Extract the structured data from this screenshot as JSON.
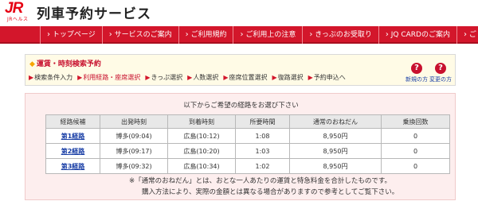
{
  "header": {
    "logo_text": "JR",
    "logo_sub": "JRヘルス",
    "title": "列車予約サービス"
  },
  "nav": {
    "items": [
      "トップページ",
      "サービスのご案内",
      "ご利用規約",
      "ご利用上の注意",
      "きっぷのお受取り",
      "JQ CARDのご案内",
      "ご"
    ]
  },
  "steps_panel": {
    "title": "運賃・時刻検索予約",
    "steps": [
      "検索条件入力",
      "利用経路・座席選択",
      "きっぷ選択",
      "人数選択",
      "座席位置選択",
      "復路選択",
      "予約申込へ"
    ],
    "current_step_index": 1
  },
  "help": {
    "new_user": {
      "icon": "?",
      "label": "新規の方"
    },
    "change": {
      "icon": "?",
      "label": "変更の方"
    }
  },
  "results": {
    "instruction": "以下からご希望の経路をお選び下さい",
    "columns": [
      "経路候補",
      "出発時刻",
      "到着時刻",
      "所要時間",
      "通常のおねだん",
      "乗換回数"
    ],
    "rows": [
      {
        "route": "第1経路",
        "depart": "博多(09:04)",
        "arrive": "広島(10:12)",
        "duration": "1:08",
        "price": "8,950円",
        "transfers": "0"
      },
      {
        "route": "第2経路",
        "depart": "博多(09:17)",
        "arrive": "広島(10:20)",
        "duration": "1:03",
        "price": "8,950円",
        "transfers": "0"
      },
      {
        "route": "第3経路",
        "depart": "博多(09:32)",
        "arrive": "広島(10:34)",
        "duration": "1:02",
        "price": "8,950円",
        "transfers": "0"
      }
    ],
    "note_line1": "※「通常のおねだん」とは、おとな一人あたりの運賃と特急料金を合計したものです。",
    "note_line2": "購入方法により、実際の金額とは異なる場合がありますので参考としてご覧下さい。"
  }
}
